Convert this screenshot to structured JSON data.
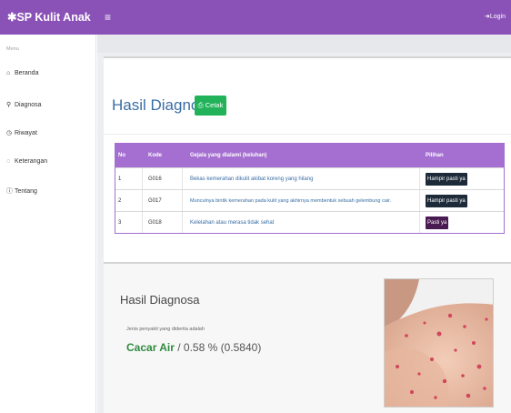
{
  "topbar": {
    "brand": "✱SP Kulit Anak",
    "menu_icon": "≡",
    "login_label": "Login"
  },
  "sidebar": {
    "heading": "Menu",
    "items": [
      {
        "icon": "home-icon",
        "glyph": "⌂",
        "label": "Beranda"
      },
      {
        "icon": "search-icon",
        "glyph": "⚲",
        "label": "Diagnosa"
      },
      {
        "icon": "history-icon",
        "glyph": "◷",
        "label": "Riwayat"
      },
      {
        "icon": "comment-icon",
        "glyph": "◌",
        "label": "Keterangan"
      },
      {
        "icon": "info-icon",
        "glyph": "ⓘ",
        "label": "Tentang"
      }
    ]
  },
  "diagnosis": {
    "title": "Hasil Diagnosis",
    "print_button": "Cetak",
    "table": {
      "headers": {
        "no": "No",
        "kode": "Kode",
        "gejala": "Gejala yang dialami (keluhan)",
        "pilihan": "Pilihan"
      },
      "rows": [
        {
          "no": "1",
          "kode": "G016",
          "gejala": "Bekas kemerahan dikulit akibat koreng yang hilang",
          "pilihan": "Hampir pasti ya"
        },
        {
          "no": "2",
          "kode": "G017",
          "gejala": "Munculnya bintik kemerahan pada kulit yang akhirnya membentuk sebuah gelembung cair.",
          "pilihan": "Hampir pasti ya"
        },
        {
          "no": "3",
          "kode": "G018",
          "gejala": "Kelelahan atau merasa tidak sehat",
          "pilihan": "Pasti ya"
        }
      ]
    }
  },
  "result": {
    "title": "Hasil Diagnosa",
    "label": "Jenis penyakit yang diderita adalah",
    "disease": "Cacar Air",
    "value": " / 0.58 % (0.5840)"
  },
  "colors": {
    "primary": "#8a51b7",
    "table_header": "#a46fd0",
    "print_button": "#22b35a",
    "pill_hampir": "#1d2a3a",
    "pill_pasti": "#4a1a52",
    "disease_text": "#2e8b3e"
  }
}
